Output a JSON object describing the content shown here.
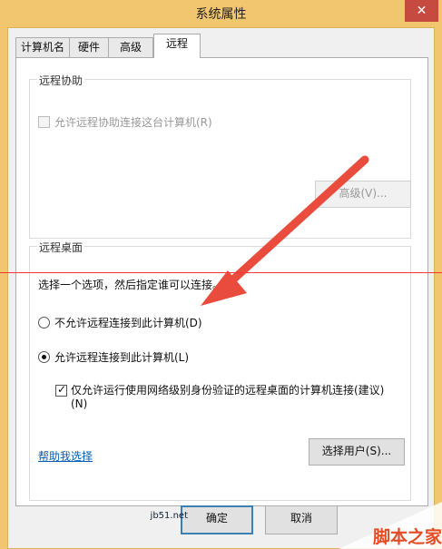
{
  "window": {
    "title": "系统属性",
    "close_label": "✕"
  },
  "tabs": [
    {
      "label": "计算机名"
    },
    {
      "label": "硬件"
    },
    {
      "label": "高级"
    },
    {
      "label": "远程"
    }
  ],
  "remote_assistance": {
    "group_label": "远程协助",
    "allow_label": "允许远程协助连接这台计算机(R)",
    "advanced_button": "高级(V)..."
  },
  "remote_desktop": {
    "group_label": "远程桌面",
    "instruction": "选择一个选项，然后指定谁可以连接。",
    "option_disallow": "不允许远程连接到此计算机(D)",
    "option_allow": "允许远程连接到此计算机(L)",
    "nla_label_line1": "仅允许运行使用网络级别身份验证的远程桌面的计算机连接(建议)",
    "nla_label_line2": "(N)",
    "help_link": "帮助我选择",
    "select_users_button": "选择用户(S)..."
  },
  "footer": {
    "ok_button": "确定",
    "cancel_button": "取消"
  },
  "watermark": {
    "url": "jb51.net",
    "text": "脚本之家"
  },
  "colors": {
    "window_frame": "#f2c66e",
    "arrow": "#e94b3c",
    "guide_line": "#ff3434",
    "link": "#005fb8"
  }
}
